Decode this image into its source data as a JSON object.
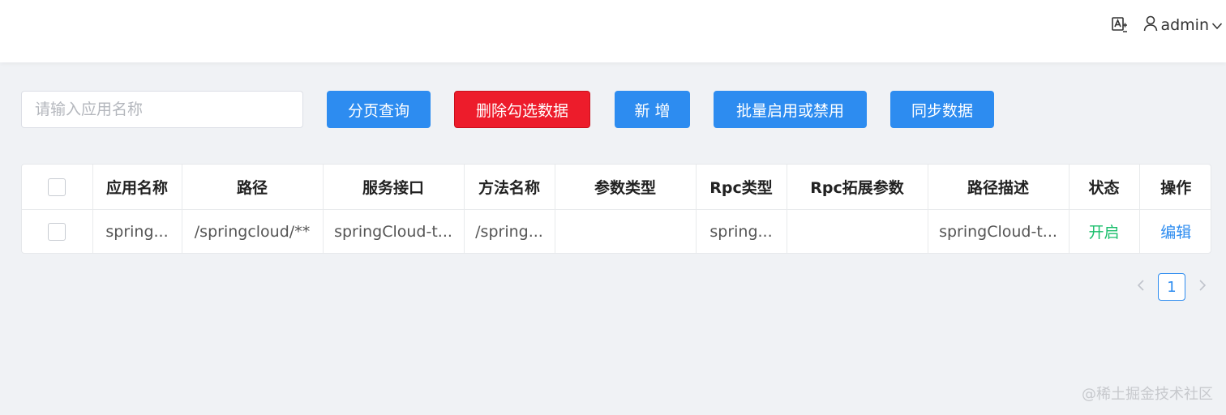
{
  "header": {
    "user_name": "admin",
    "translate_icon": "translate-icon",
    "user_icon": "user-icon",
    "dropdown_icon": "chevron-down-icon"
  },
  "toolbar": {
    "search_placeholder": "请输入应用名称",
    "search_value": "",
    "page_query_label": "分页查询",
    "delete_selected_label": "删除勾选数据",
    "add_label": "新 增",
    "batch_toggle_label": "批量启用或禁用",
    "sync_label": "同步数据"
  },
  "table": {
    "columns": [
      "应用名称",
      "路径",
      "服务接口",
      "方法名称",
      "参数类型",
      "Rpc类型",
      "Rpc拓展参数",
      "路径描述",
      "状态",
      "操作"
    ],
    "rows": [
      {
        "app_name": "spring...",
        "path": "/springcloud/**",
        "service_interface": "springCloud-t...",
        "method_name": "/spring...",
        "param_type": "",
        "rpc_type": "spring...",
        "rpc_ext": "",
        "path_desc": "springCloud-t...",
        "status": "开启",
        "action": "编辑"
      }
    ]
  },
  "pagination": {
    "current_page": "1",
    "prev_icon": "chevron-left-icon",
    "next_icon": "chevron-right-icon"
  },
  "watermark": "@稀土掘金技术社区",
  "colors": {
    "primary": "#2d8cf0",
    "danger": "#ed1c2b",
    "success": "#19be6b",
    "background": "#f0f2f5"
  }
}
